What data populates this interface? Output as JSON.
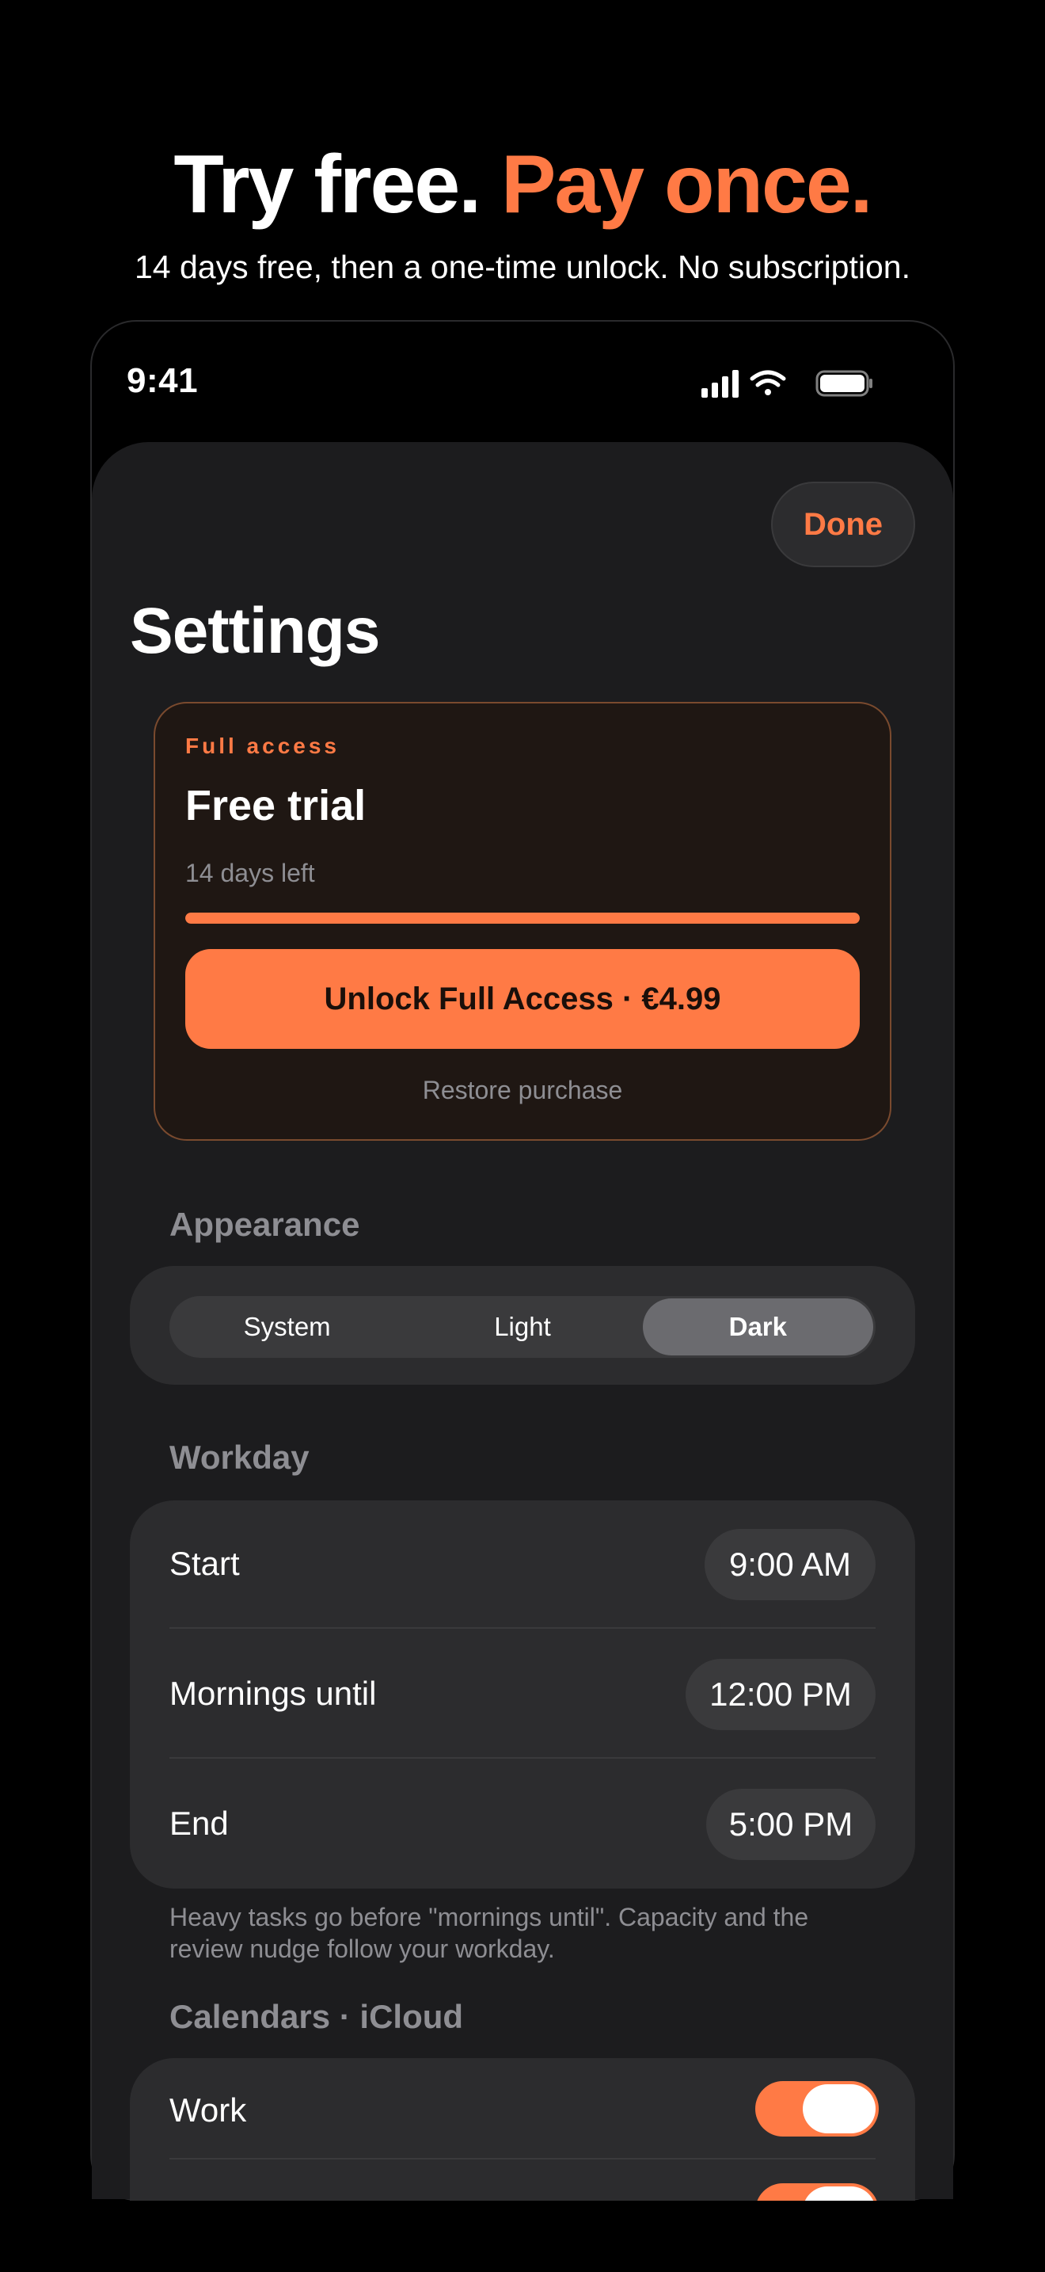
{
  "colors": {
    "accent": "#ff7a45",
    "background": "#000000",
    "sheet": "#1c1c1e"
  },
  "promo": {
    "headline_plain": "Try free.",
    "headline_accent": "Pay once.",
    "subhead": "14 days free, then a one-time unlock. No subscription."
  },
  "status_bar": {
    "time": "9:41",
    "icons": [
      "cellular-signal-icon",
      "wifi-icon",
      "battery-icon"
    ]
  },
  "header": {
    "done_label": "Done",
    "title": "Settings"
  },
  "trial": {
    "eyebrow": "Full access",
    "title": "Free trial",
    "days_left": "14 days left",
    "progress_fraction": 1.0,
    "unlock_label": "Unlock Full Access · €4.99",
    "restore_label": "Restore purchase"
  },
  "appearance": {
    "header": "Appearance",
    "options": [
      "System",
      "Light",
      "Dark"
    ],
    "selected": "Dark"
  },
  "workday": {
    "header": "Workday",
    "rows": [
      {
        "label": "Start",
        "value": "9:00 AM"
      },
      {
        "label": "Mornings until",
        "value": "12:00 PM"
      },
      {
        "label": "End",
        "value": "5:00 PM"
      }
    ],
    "footnote": "Heavy tasks go before \"mornings until\". Capacity and the review nudge follow your workday."
  },
  "calendars": {
    "header": "Calendars · iCloud",
    "items": [
      {
        "label": "Work",
        "enabled": true
      },
      {
        "label": "",
        "enabled": true
      }
    ]
  }
}
